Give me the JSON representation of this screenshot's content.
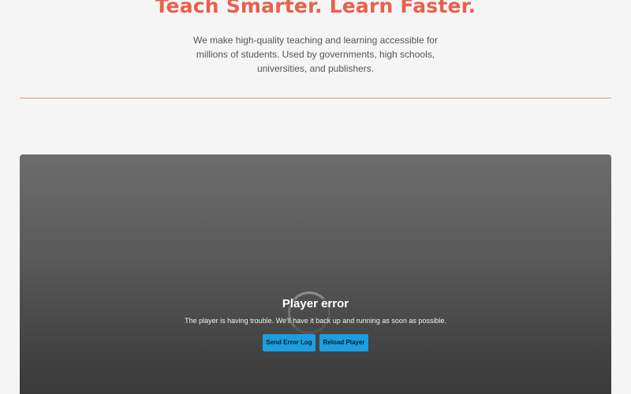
{
  "hero": {
    "title": "Teach Smarter. Learn Faster.",
    "subtitle": "We make high-quality teaching and learning accessible for millions of students. Used by governments, high schools, universities, and publishers."
  },
  "player": {
    "error_title": "Player error",
    "error_message": "The player is having trouble. We'll have it back up and running as soon as possible.",
    "send_error_log_label": "Send Error Log",
    "reload_player_label": "Reload Player"
  },
  "colors": {
    "accent": "#e8604c",
    "divider": "#ec8a80",
    "button": "#1a9fe0",
    "page_background": "#f5f5f5"
  },
  "icons": {
    "spinner": "loading-spinner-icon"
  }
}
